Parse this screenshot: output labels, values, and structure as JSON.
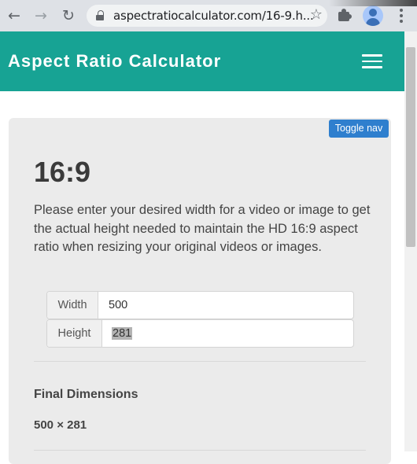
{
  "browser": {
    "back_icon": "←",
    "forward_icon": "→",
    "reload_icon": "↻",
    "url": "aspectratiocalculator.com/16-9.h...",
    "bookmark_icon": "☆"
  },
  "header": {
    "brand": "Aspect Ratio Calculator",
    "color": "#17a394"
  },
  "page": {
    "toggle_nav": "Toggle nav",
    "title": "16:9",
    "description": "Please enter your desired width for a video or image to get the actual height needed to maintain the HD 16:9 aspect ratio when resizing your original videos or images.",
    "width_label": "Width",
    "width_value": "500",
    "height_label": "Height",
    "height_value": "281",
    "final_heading": "Final Dimensions",
    "final_value": "500 × 281"
  },
  "colors": {
    "accent": "#17a394",
    "button": "#2f7fce"
  }
}
